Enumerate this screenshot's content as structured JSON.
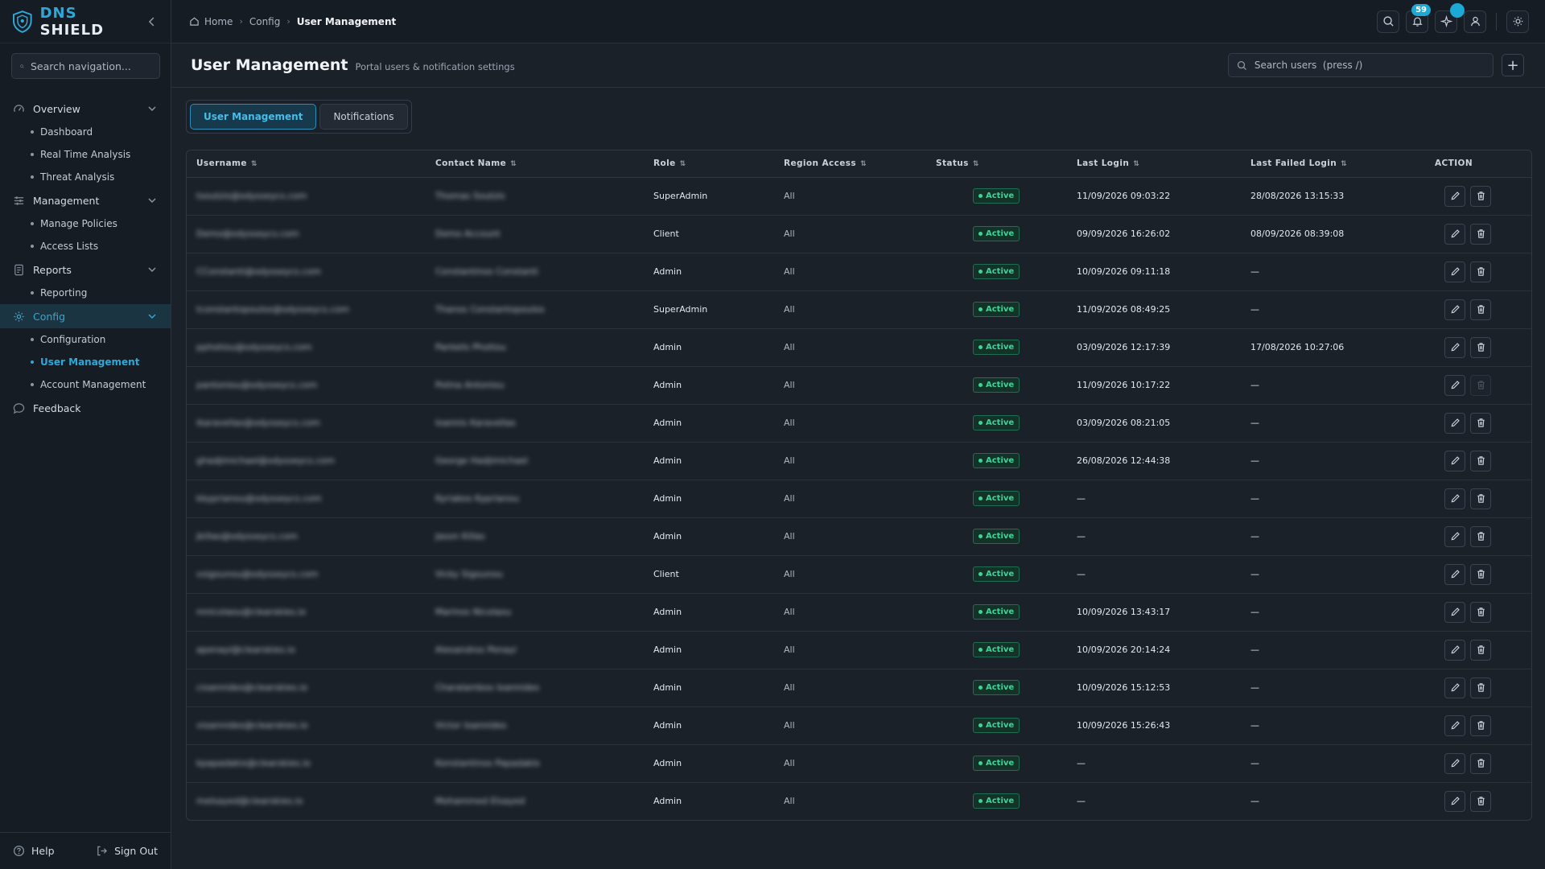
{
  "brand": {
    "name_part1": "DNS",
    "name_part2": "SHIELD",
    "accent": "#2fa8d8"
  },
  "sidebar": {
    "search_placeholder": "Search navigation...",
    "groups": [
      {
        "label": "Overview",
        "icon": "gauge-icon",
        "items": [
          "Dashboard",
          "Real Time Analysis",
          "Threat Analysis"
        ]
      },
      {
        "label": "Management",
        "icon": "sliders-icon",
        "items": [
          "Manage Policies",
          "Access Lists"
        ]
      },
      {
        "label": "Reports",
        "icon": "report-icon",
        "items": [
          "Reporting"
        ]
      },
      {
        "label": "Config",
        "icon": "gear-icon",
        "active": true,
        "items": [
          "Configuration",
          "User Management",
          "Account Management"
        ]
      },
      {
        "label": "Feedback",
        "icon": "chat-icon",
        "items": []
      }
    ],
    "active_item": "User Management",
    "footer": {
      "help": "Help",
      "sign_out": "Sign Out"
    }
  },
  "topbar": {
    "breadcrumb": [
      "Home",
      "Config",
      "User Management"
    ],
    "notification_count": "59"
  },
  "page": {
    "title": "User Management",
    "subtitle": "Portal users & notification settings",
    "search_placeholder": "Search users  (press /)",
    "add_label": "+"
  },
  "tabs": [
    {
      "label": "User Management",
      "active": true
    },
    {
      "label": "Notifications",
      "active": false
    }
  ],
  "table": {
    "columns": [
      "Username",
      "Contact Name",
      "Role",
      "Region Access",
      "Status",
      "Last Login",
      "Last Failed Login",
      "ACTION"
    ],
    "rows": [
      {
        "username": "tsoutzis@odysseycs.com",
        "contact": "Thomas Soutzis",
        "role": "SuperAdmin",
        "region": "All",
        "status": "Active",
        "last_login": "11/09/2026 09:03:22",
        "last_failed": "28/08/2026 13:15:33",
        "delete_enabled": true
      },
      {
        "username": "Demo@odysseycs.com",
        "contact": "Demo Account",
        "role": "Client",
        "region": "All",
        "status": "Active",
        "last_login": "09/09/2026 16:26:02",
        "last_failed": "08/09/2026 08:39:08",
        "delete_enabled": true
      },
      {
        "username": "CConstanti@odysseycs.com",
        "contact": "Constantinos Constanti",
        "role": "Admin",
        "region": "All",
        "status": "Active",
        "last_login": "10/09/2026 09:11:18",
        "last_failed": "—",
        "delete_enabled": true
      },
      {
        "username": "tconstantopoulos@odysseycs.com",
        "contact": "Thanos Constantopoulos",
        "role": "SuperAdmin",
        "region": "All",
        "status": "Active",
        "last_login": "11/09/2026 08:49:25",
        "last_failed": "—",
        "delete_enabled": true
      },
      {
        "username": "pphotiou@odysseycs.com",
        "contact": "Pantelis Photiou",
        "role": "Admin",
        "region": "All",
        "status": "Active",
        "last_login": "03/09/2026 12:17:39",
        "last_failed": "17/08/2026 10:27:06",
        "delete_enabled": true
      },
      {
        "username": "pantoniou@odysseycs.com",
        "contact": "Polina Antoniou",
        "role": "Admin",
        "region": "All",
        "status": "Active",
        "last_login": "11/09/2026 10:17:22",
        "last_failed": "—",
        "delete_enabled": false
      },
      {
        "username": "ikaravellas@odysseycs.com",
        "contact": "Ioannis Karavellas",
        "role": "Admin",
        "region": "All",
        "status": "Active",
        "last_login": "03/09/2026 08:21:05",
        "last_failed": "—",
        "delete_enabled": true
      },
      {
        "username": "ghadjimichael@odysseycs.com",
        "contact": "George Hadjimichael",
        "role": "Admin",
        "region": "All",
        "status": "Active",
        "last_login": "26/08/2026 12:44:38",
        "last_failed": "—",
        "delete_enabled": true
      },
      {
        "username": "kkyprianou@odysseycs.com",
        "contact": "Kyriakos Kyprianou",
        "role": "Admin",
        "region": "All",
        "status": "Active",
        "last_login": "—",
        "last_failed": "—",
        "delete_enabled": true
      },
      {
        "username": "jkillas@odysseycs.com",
        "contact": "Jason Killas",
        "role": "Admin",
        "region": "All",
        "status": "Active",
        "last_login": "—",
        "last_failed": "—",
        "delete_enabled": true
      },
      {
        "username": "vsigounou@odysseycs.com",
        "contact": "Vicky Sigounou",
        "role": "Client",
        "region": "All",
        "status": "Active",
        "last_login": "—",
        "last_failed": "—",
        "delete_enabled": true
      },
      {
        "username": "mnicolaou@clearskies.io",
        "contact": "Marinos Nicolaou",
        "role": "Admin",
        "region": "All",
        "status": "Active",
        "last_login": "10/09/2026 13:43:17",
        "last_failed": "—",
        "delete_enabled": true
      },
      {
        "username": "apenayi@clearskies.io",
        "contact": "Alexandros Penayi",
        "role": "Admin",
        "region": "All",
        "status": "Active",
        "last_login": "10/09/2026 20:14:24",
        "last_failed": "—",
        "delete_enabled": true
      },
      {
        "username": "cioannides@clearskies.io",
        "contact": "Charalambos Ioannides",
        "role": "Admin",
        "region": "All",
        "status": "Active",
        "last_login": "10/09/2026 15:12:53",
        "last_failed": "—",
        "delete_enabled": true
      },
      {
        "username": "vioannides@clearskies.io",
        "contact": "Victor Ioannides",
        "role": "Admin",
        "region": "All",
        "status": "Active",
        "last_login": "10/09/2026 15:26:43",
        "last_failed": "—",
        "delete_enabled": true
      },
      {
        "username": "kpapadakis@clearskies.io",
        "contact": "Konstantinos Papadakis",
        "role": "Admin",
        "region": "All",
        "status": "Active",
        "last_login": "—",
        "last_failed": "—",
        "delete_enabled": true
      },
      {
        "username": "melsayed@clearskies.io",
        "contact": "Mohammed Elsayed",
        "role": "Admin",
        "region": "All",
        "status": "Active",
        "last_login": "—",
        "last_failed": "—",
        "delete_enabled": true
      }
    ]
  }
}
